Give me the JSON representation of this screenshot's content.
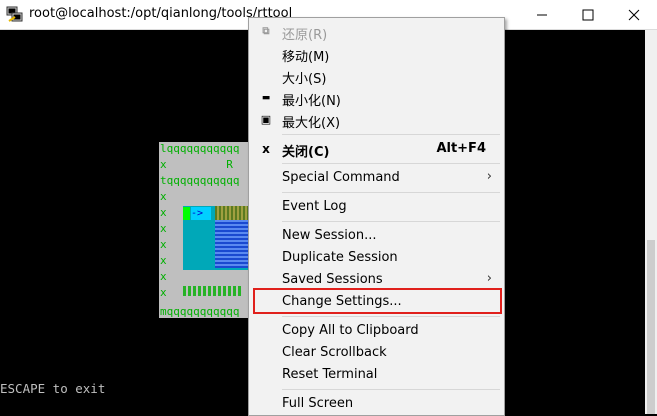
{
  "window": {
    "title": "root@localhost:/opt/qianlong/tools/rttool",
    "icons": {
      "app": "putty-icon",
      "minimize": "minimize-icon",
      "maximize": "maximize-icon",
      "close": "close-icon"
    }
  },
  "terminal": {
    "escape_hint": "ESCAPE to exit",
    "tui_lines": {
      "l1": "lqqqqqqqqqqq",
      "l2": "x         R",
      "l3": "tqqqqqqqqqqq",
      "l4": "x",
      "l5": "x",
      "l6": "x",
      "l7": "x",
      "l8": "x",
      "l9": "x",
      "l10": "x",
      "l11": "mqqqqqqqqqqq",
      "arrow": "->"
    }
  },
  "menu": {
    "restore": "还原(R)",
    "move": "移动(M)",
    "size": "大小(S)",
    "minimize": "最小化(N)",
    "maximize": "最大化(X)",
    "close": "关闭(C)",
    "close_accel": "Alt+F4",
    "special_command": "Special Command",
    "event_log": "Event Log",
    "new_session": "New Session...",
    "duplicate_session": "Duplicate Session",
    "saved_sessions": "Saved Sessions",
    "change_settings": "Change Settings...",
    "copy_all": "Copy All to Clipboard",
    "clear_scrollback": "Clear Scrollback",
    "reset_terminal": "Reset Terminal",
    "full_screen": "Full Screen",
    "submenu_arrow": "›",
    "icon_minimize": "▬",
    "icon_maximize": "▣",
    "icon_close": "x"
  },
  "colors": {
    "highlight": "#e0201c",
    "menu_bg": "#f2f2f2",
    "terminal_bg": "#000000",
    "tui_text": "#00b000"
  }
}
